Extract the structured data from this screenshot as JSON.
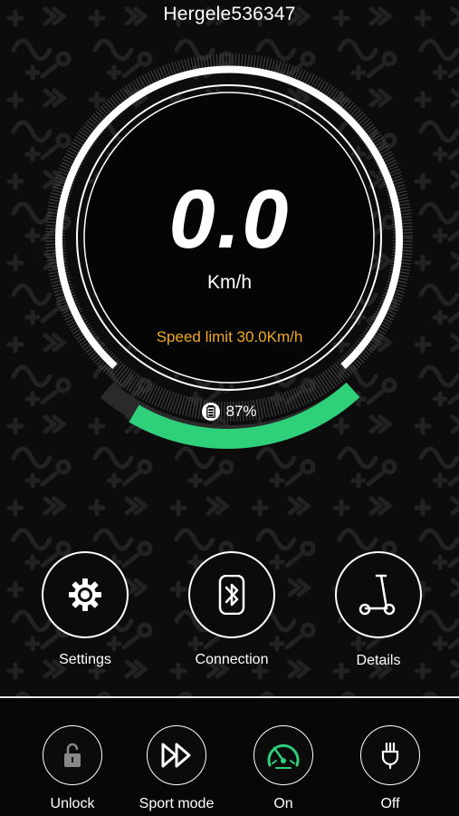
{
  "header": {
    "device_name": "Hergele536347"
  },
  "dashboard": {
    "speed": "0.0",
    "unit": "Km/h",
    "speed_limit": "Speed limit 30.0Km/h",
    "battery_text": "87%",
    "battery_percent": 87
  },
  "actions": [
    {
      "label": "Settings",
      "icon": "gear-icon"
    },
    {
      "label": "Connection",
      "icon": "bluetooth-icon"
    },
    {
      "label": "Details",
      "icon": "scooter-icon"
    }
  ],
  "bottom_bar": [
    {
      "label": "Unlock",
      "icon": "padlock-open-icon"
    },
    {
      "label": "Sport mode",
      "icon": "fast-forward-icon"
    },
    {
      "label": "On",
      "icon": "speedometer-icon"
    },
    {
      "label": "Off",
      "icon": "plug-icon"
    }
  ],
  "colors": {
    "accent_green": "#2fd07a",
    "speed_limit_orange": "#f0a81c",
    "background": "#0c0c0c"
  }
}
